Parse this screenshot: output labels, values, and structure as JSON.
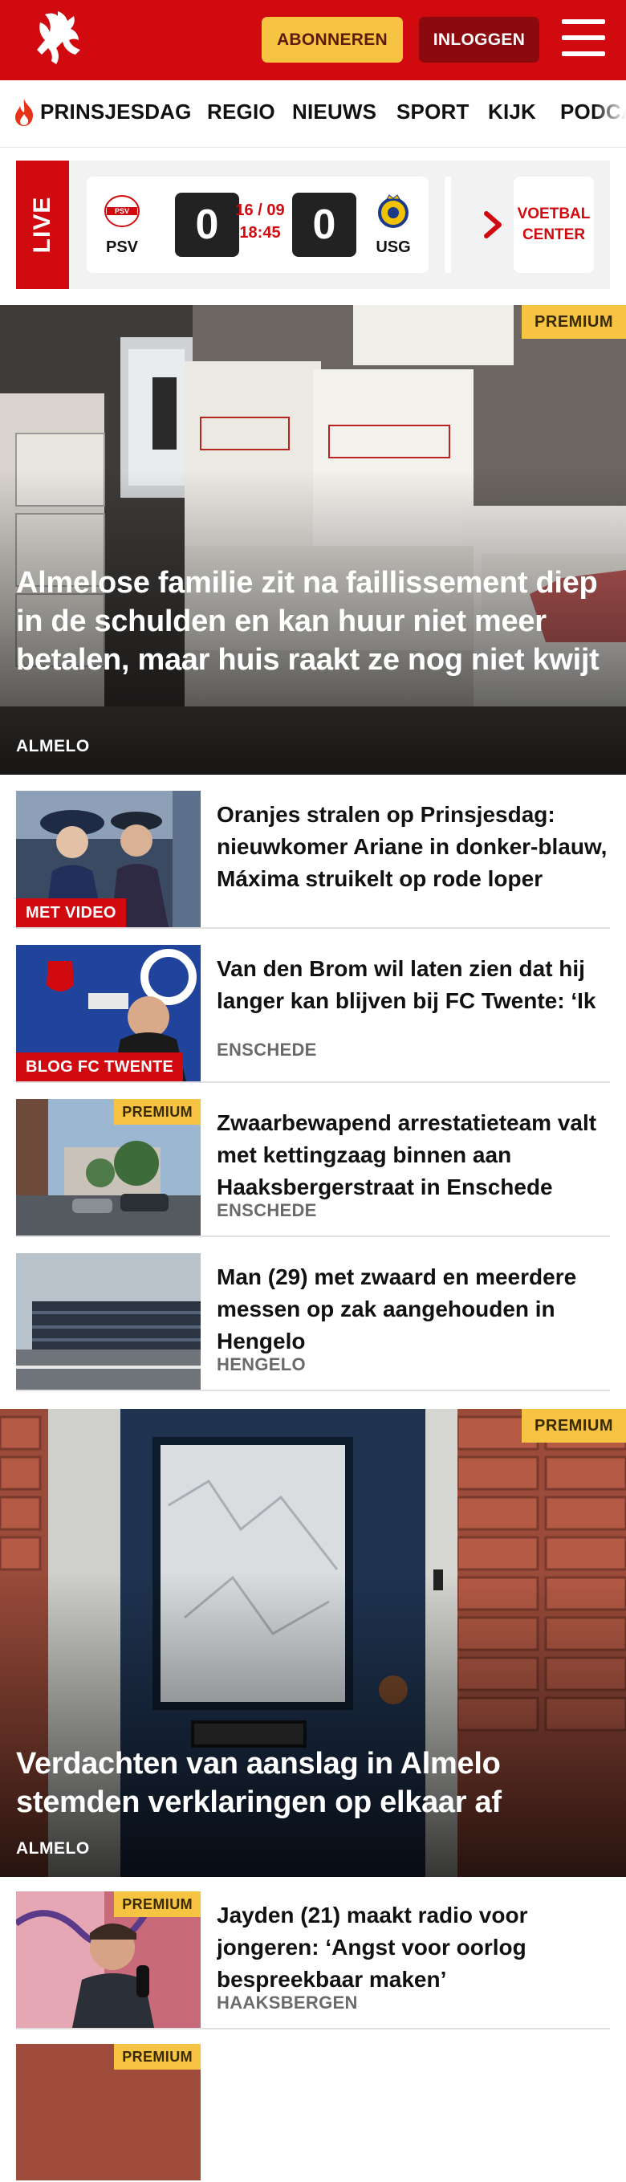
{
  "header": {
    "subscribe_label": "ABONNEREN",
    "login_label": "INLOGGEN",
    "brand_color": "#d10a10"
  },
  "nav": {
    "items": [
      "PRINSJESDAG",
      "REGIO",
      "NIEUWS",
      "SPORT",
      "KIJK",
      "PODCA"
    ],
    "first_icon": "flame-icon"
  },
  "live": {
    "label": "LIVE",
    "match": {
      "home": "PSV",
      "away": "USG",
      "home_score": "0",
      "away_score": "0",
      "date": "16 / 09",
      "time": "18:45"
    },
    "center_label": "VOETBAL CENTER"
  },
  "hero1": {
    "badge": "PREMIUM",
    "headline": "Almelose familie zit na faillissement diep in de schulden en kan huur niet meer betalen, maar huis raakt ze nog niet kwijt",
    "place": "ALMELO"
  },
  "list1": [
    {
      "label": "MET VIDEO",
      "premium": "",
      "title": "Oranjes stralen op Prinsjesdag: nieuwkomer Ariane in donker-blauw, Máxima struikelt op rode loper",
      "place": ""
    },
    {
      "label": "BLOG FC TWENTE",
      "premium": "",
      "title": "Van den Brom wil laten zien dat hij langer kan blijven bij FC Twente: ‘Ik zie mezelf niet als een interim’",
      "place": "ENSCHEDE"
    },
    {
      "label": "",
      "premium": "PREMIUM",
      "title": "Zwaarbewapend arrestatieteam valt met kettingzaag binnen aan Haaksbergerstraat in Enschede",
      "place": "ENSCHEDE"
    },
    {
      "label": "",
      "premium": "",
      "title": "Man (29) met zwaard en meerdere messen op zak aangehouden in Hengelo",
      "place": "HENGELO"
    }
  ],
  "hero2": {
    "badge": "PREMIUM",
    "headline": "Verdachten van aanslag in Almelo stemden verklaringen op elkaar af",
    "place": "ALMELO"
  },
  "list2": [
    {
      "label": "",
      "premium": "PREMIUM",
      "title": "Jayden (21) maakt radio voor jongeren: ‘Angst voor oorlog bespreekbaar maken’",
      "place": "HAAKSBERGEN"
    },
    {
      "label": "",
      "premium": "PREMIUM",
      "title": "",
      "place": ""
    }
  ]
}
